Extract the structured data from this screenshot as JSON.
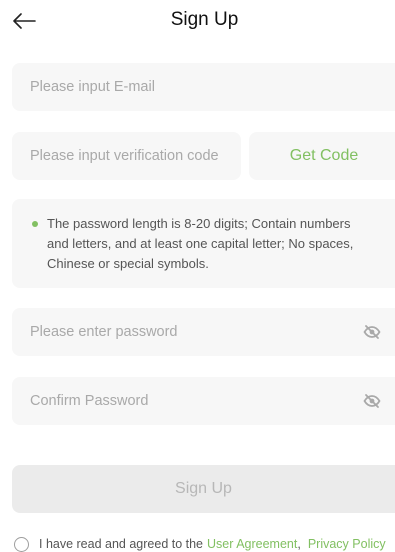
{
  "header": {
    "back_icon": "arrow-left-icon",
    "title": "Sign Up"
  },
  "form": {
    "email": {
      "placeholder": "Please input E-mail",
      "value": ""
    },
    "verification": {
      "placeholder": "Please input verification code",
      "value": "",
      "get_code_label": "Get Code"
    },
    "password_hint": {
      "bullet_icon": "dot-icon",
      "lines": [
        "The password length is 8-20 digits; Contain numbers",
        "and letters, and at least one capital letter; No spaces,",
        "Chinese or special symbols."
      ]
    },
    "password": {
      "placeholder": "Please enter password",
      "value": "",
      "visibility_icon": "eye-off-icon"
    },
    "confirm_password": {
      "placeholder": "Confirm Password",
      "value": "",
      "visibility_icon": "eye-off-icon"
    },
    "submit_label": "Sign Up"
  },
  "agreement": {
    "checked": false,
    "checkbox_icon": "radio-unchecked-icon",
    "prefix": "I have read and agreed to the",
    "user_agreement": "User Agreement",
    "separator": ",",
    "privacy_policy": "Privacy Policy"
  },
  "colors": {
    "accent": "#82c062",
    "field_bg": "#f7f7f7",
    "placeholder": "#a9a9a9",
    "hint_text": "#555555",
    "button_disabled_bg": "#ebebeb",
    "button_disabled_text": "#b7b7b7"
  }
}
